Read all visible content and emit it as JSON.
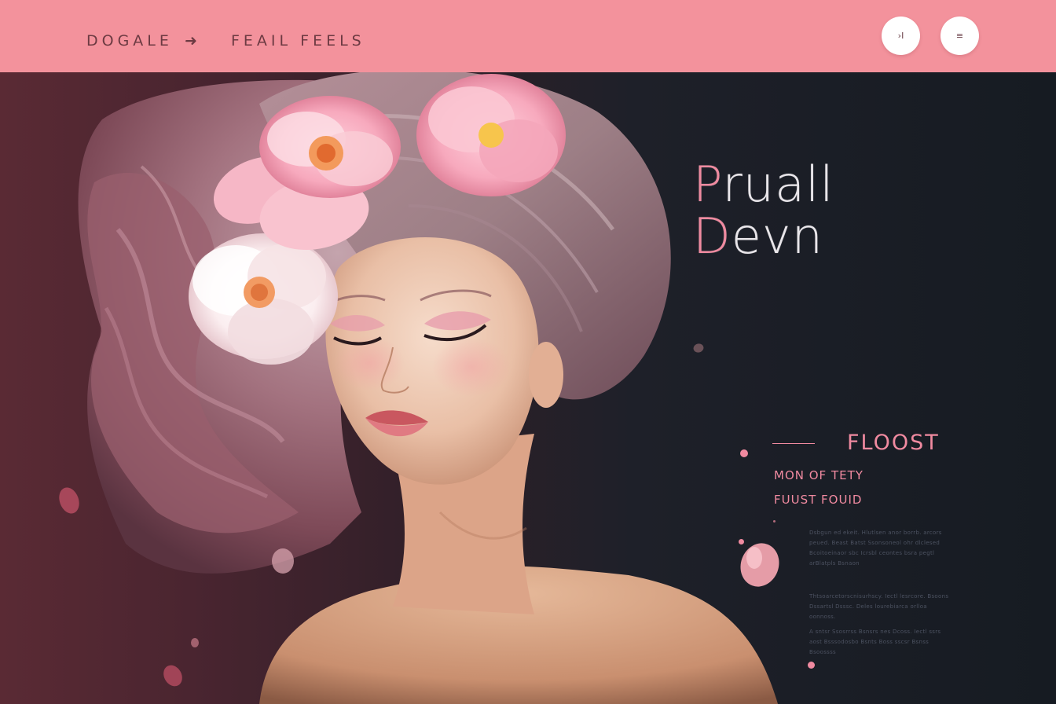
{
  "header": {
    "brand": "DOGALE",
    "brand_arrow": "➜",
    "title": "FEAIL FEELS",
    "button_1_glyph": "›I",
    "button_2_glyph": "≡"
  },
  "hero": {
    "headline_line_1": "Pruall",
    "headline_line_2": "Devn"
  },
  "section": {
    "title": "FLOOST",
    "link_1": "MON OF TETY",
    "link_2": "FUUST FOUID"
  },
  "paragraphs": {
    "p1": "Dsbgun ed ekeit. Hlutlsen anor borrb. arcors peued. Beast Batst Ssonsoneol ohr dlclesed Bcoitoeinaor sbc Icrsbl ceontes bsra pegtl arBlatpls Bsnaon",
    "p2": "Thtsoarcetorscnisurhscy. Iectl lesrcore. Bsoons Dssartsl Dsssc. Deles lourebiarca orlloa oonnoss.",
    "p3": "A sntsr Ssosrrss Bsnsrs nes Dcoss. Iectl ssrs aost Bsssodosbo Bsnts Boss sscsr Bsnss Bsoossss"
  },
  "colors": {
    "header_bg": "#f3929c",
    "accent": "#f08aa0",
    "hero_dark": "#161b22",
    "hero_wine": "#5a2a34"
  }
}
